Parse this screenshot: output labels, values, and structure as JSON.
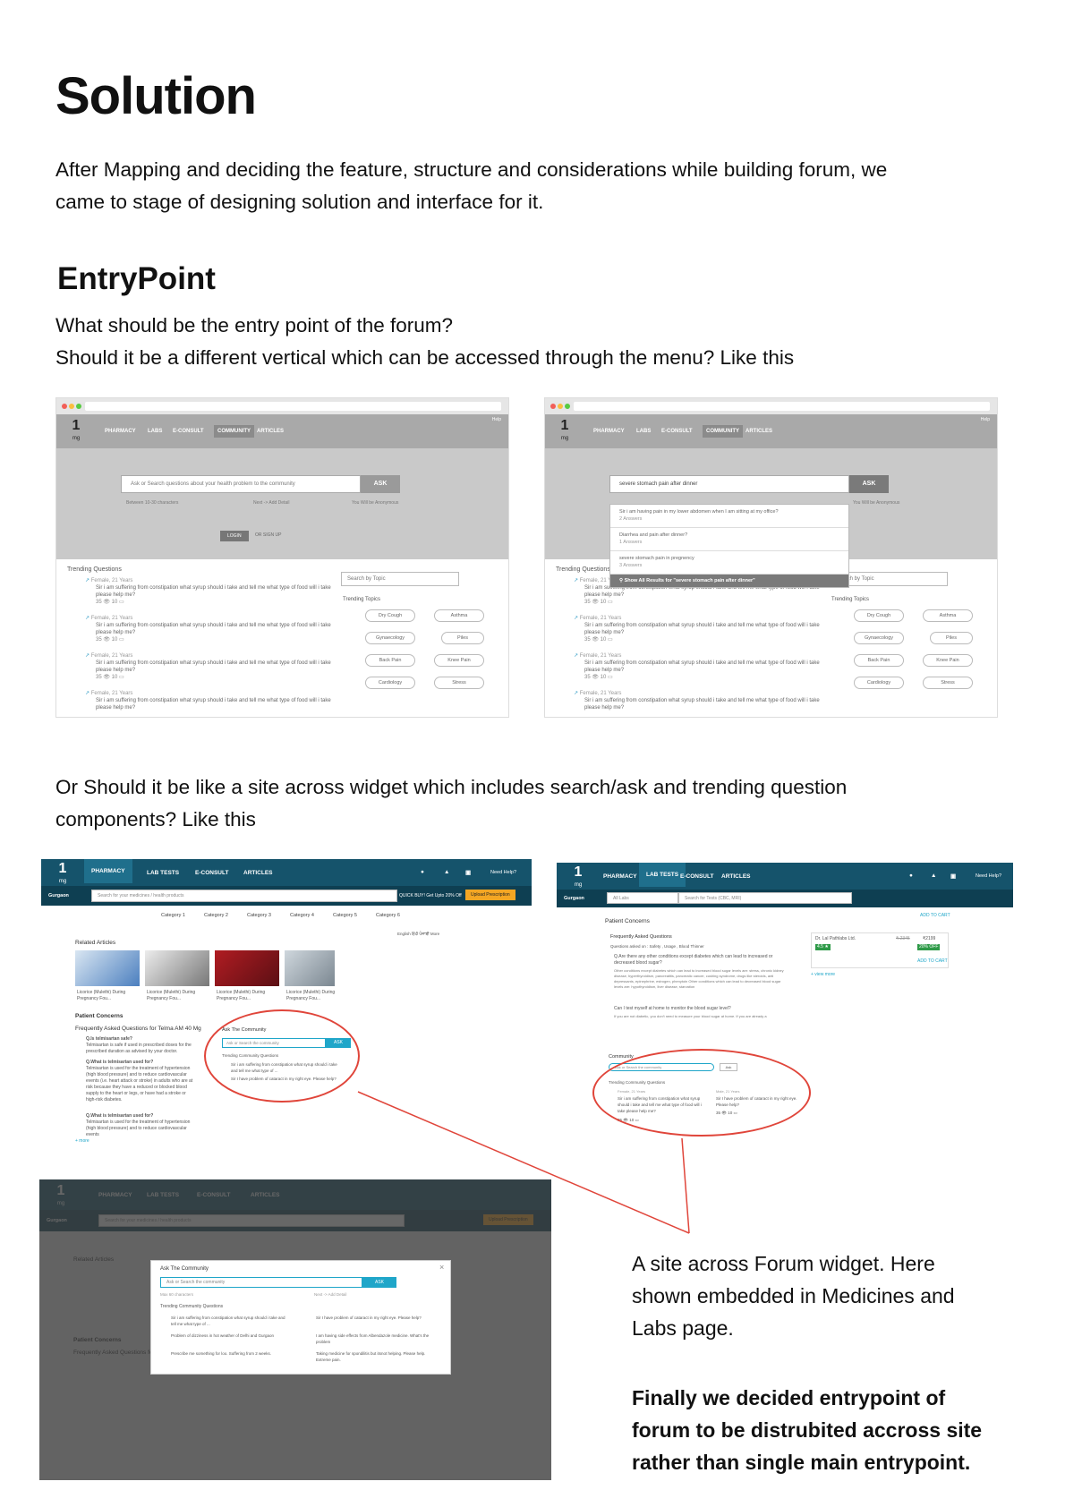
{
  "title": "Solution",
  "intro": [
    "After Mapping and deciding the feature, structure and considerations while building forum, we",
    "came to stage of designing solution and interface for it."
  ],
  "entrypoint_heading": "EntryPoint",
  "question1": [
    "What should be the entry point of the forum?",
    "Should it be a different vertical which can be accessed through the menu? Like this"
  ],
  "question2": [
    "Or Should it be like a site across widget which includes search/ask and trending question",
    "components? Like this"
  ],
  "caption": [
    "A site across Forum widget. Here",
    "shown embedded in Medicines and",
    "Labs page."
  ],
  "conclusion": [
    "Finally we decided entrypoint of",
    "forum to be distrubited accross site",
    "rather than single main entrypoint."
  ],
  "mock_vertical": {
    "logo": "1",
    "logo_sub": "mg",
    "nav": [
      "PHARMACY",
      "LABS",
      "E-CONSULT",
      "COMMUNITY",
      "ARTICLES"
    ],
    "help": "Help",
    "search_placeholder": "Ask or Search questions about your health problem to the community",
    "search_typed": "severe stomach pain after dinner",
    "ask": "ASK",
    "hint_left": "Between 10-30 characters",
    "hint_mid": "Next -> Add Detail",
    "hint_right": "You Will be Anonymous",
    "login": "LOGIN",
    "signup": "OR  SIGN UP",
    "trending": "Trending Questions",
    "question_meta": "Female, 21 Years",
    "question_text": "Sir i am suffering from constipation what syrup should i take and tell me what type of food will i take please help me?",
    "stats": "35 👁   10 ▭",
    "topic_search": "Search by Topic",
    "trending_topics": "Trending Topics",
    "topics": [
      "Dry Cough",
      "Asthma",
      "Gynaecology",
      "Piles",
      "Back Pain",
      "Knee Pain",
      "Cardiology",
      "Stress"
    ],
    "suggestions": [
      {
        "q": "Sir i am having pain in my lower abdomen when I am sitting at my office?",
        "a": "2 Answers"
      },
      {
        "q": "Diarrhea and pain after dinner?",
        "a": "1 Answers"
      },
      {
        "q": "severe stomach pain in pregnency",
        "a": "3 Answers"
      }
    ],
    "show_all": "Show All Results for \"severe stomach pain after dinner\""
  },
  "mock_pharmacy": {
    "nav": [
      "PHARMACY",
      "LAB TESTS",
      "E-CONSULT",
      "ARTICLES"
    ],
    "need_help": "Need Help?",
    "city": "Gurgaon",
    "search": "Search for your medicines / health products",
    "quick_buy": "QUICK BUY! Get Upto 20% Off",
    "upload": "Upload Prescription",
    "categories": [
      "Category 1",
      "Category 2",
      "Category 3",
      "Category 4",
      "Category 5",
      "Category 6"
    ],
    "languages": "English   हिंदी   ਪੰਜਾਬੀ   More",
    "related_articles": "Related Articles",
    "article_caption": "Licorice (Mulethi) During Pregnancy Fou...",
    "patient_concerns": "Patient Concerns",
    "faq_title": "Frequently Asked Questions for Telma AM 40 Mg",
    "faqs": [
      {
        "q": "Q.Is telmisartan safe?",
        "a": "Telmisartan is safe if used in prescribed doses for the prescribed duration as advised by your doctor."
      },
      {
        "q": "Q.What is telmisartan used for?",
        "a": "Telmisartan is used for the treatment of hypertension (high blood pressure) and to reduce cardiovascular events (i.e. heart attack or stroke) in adults who are at risk because they have a reduced or blocked blood supply to the heart or legs, or have had a stroke or high-risk diabetes."
      },
      {
        "q": "Q.What is telmisartan used for?",
        "a": "Telmisartan is used for the treatment of hypertension (high blood pressure) and to reduce cardiovascular events"
      }
    ],
    "more": "+ more",
    "ask_community": "Ask The Community",
    "ask_placeholder": "Ask or Search the community",
    "ask": "ASK",
    "trending_community": "Trending Community Questions",
    "tq": [
      "Sir i am suffering from constipation what syrup should i take and tell me what type of ...",
      "Sir I have problem of cataract in my right eye. Please help?"
    ]
  },
  "mock_labs": {
    "nav": [
      "PHARMACY",
      "LAB TESTS",
      "E-CONSULT",
      "ARTICLES"
    ],
    "need_help": "Need Help?",
    "city": "Gurgaon",
    "all_labs": "All Labs",
    "search": "Search for Tests (CBC, MRI)",
    "add_to_cart": "ADD TO CART",
    "patient_concerns": "Patient Concerns",
    "faq": "Frequently Asked Questions",
    "asked_on": "Questions asked on : Safety , Usage , Blood Thinner",
    "q1": "Q.Are there any other conditions except diabetes which can lead to increased or decreased blood sugar?",
    "a1": "Other conditions except diabetes which can lead to increased blood sugar levels are: stress, chronic kidney disease, hyperthyroidism, pancreatitis, pancreatic cancer, cushing syndrome, drugs like steroids, anti depressants, epinephrine, estrogen, phenytoin Other conditions which can lead to decreased blood sugar levels are: hypothyroidism, liver disease, starvation",
    "q2": "Can I test myself at home to monitor the blood sugar level?",
    "a2": "If you are not diabetic, you don't need to measure your blood sugar at home. If you are already a",
    "lab_name": "Dr. Lal Pathlabs Ltd.",
    "price_old": "₹ 2345",
    "price": "₹2199",
    "discount": "20% OFF",
    "rating": "4.5 ★",
    "more": "+ view more",
    "community": "Community",
    "ask_placeholder": "Ask or Search the community",
    "ask": "Ask",
    "trending_community": "Trending Community Questions",
    "meta1": "Female, 21 Years",
    "meta2": "Male, 21 Years",
    "tq1": "Sir i am suffering from constipation what syrup should i take and tell me what type of food will i take please help me?",
    "tq2": "Sir I have problem of cataract in my right eye. Please help?",
    "stats": "35 👁   10 ▭"
  },
  "mock_modal": {
    "title": "Ask The Community",
    "placeholder": "Ask or Search the community",
    "ask": "ASK",
    "hint_left": "Max 60 characters",
    "hint_right": "Next -> Add Detail",
    "trending": "Trending Community Questions",
    "questions": [
      "Sir i am suffering from constipation what syrup should i take and tell me what type of ...",
      "Sir I have problem of cataract in my right eye. Please help?",
      "Problem of dizziness in hot weather of Delhi and Gurgaon",
      "I am having side effects from Albendazole medicine. What's the problem",
      "Prescribe me something for loo. Suffering from 2 weeks.",
      "Taking medicine for spondilitis but itsnot helping. Please help. Extreme pain."
    ],
    "close": "×"
  },
  "colors": {
    "nav": "#15536b",
    "subnav": "#0e3f52",
    "accent": "#1fa6c9",
    "red": "#e0453a",
    "orange": "#f4a623"
  }
}
